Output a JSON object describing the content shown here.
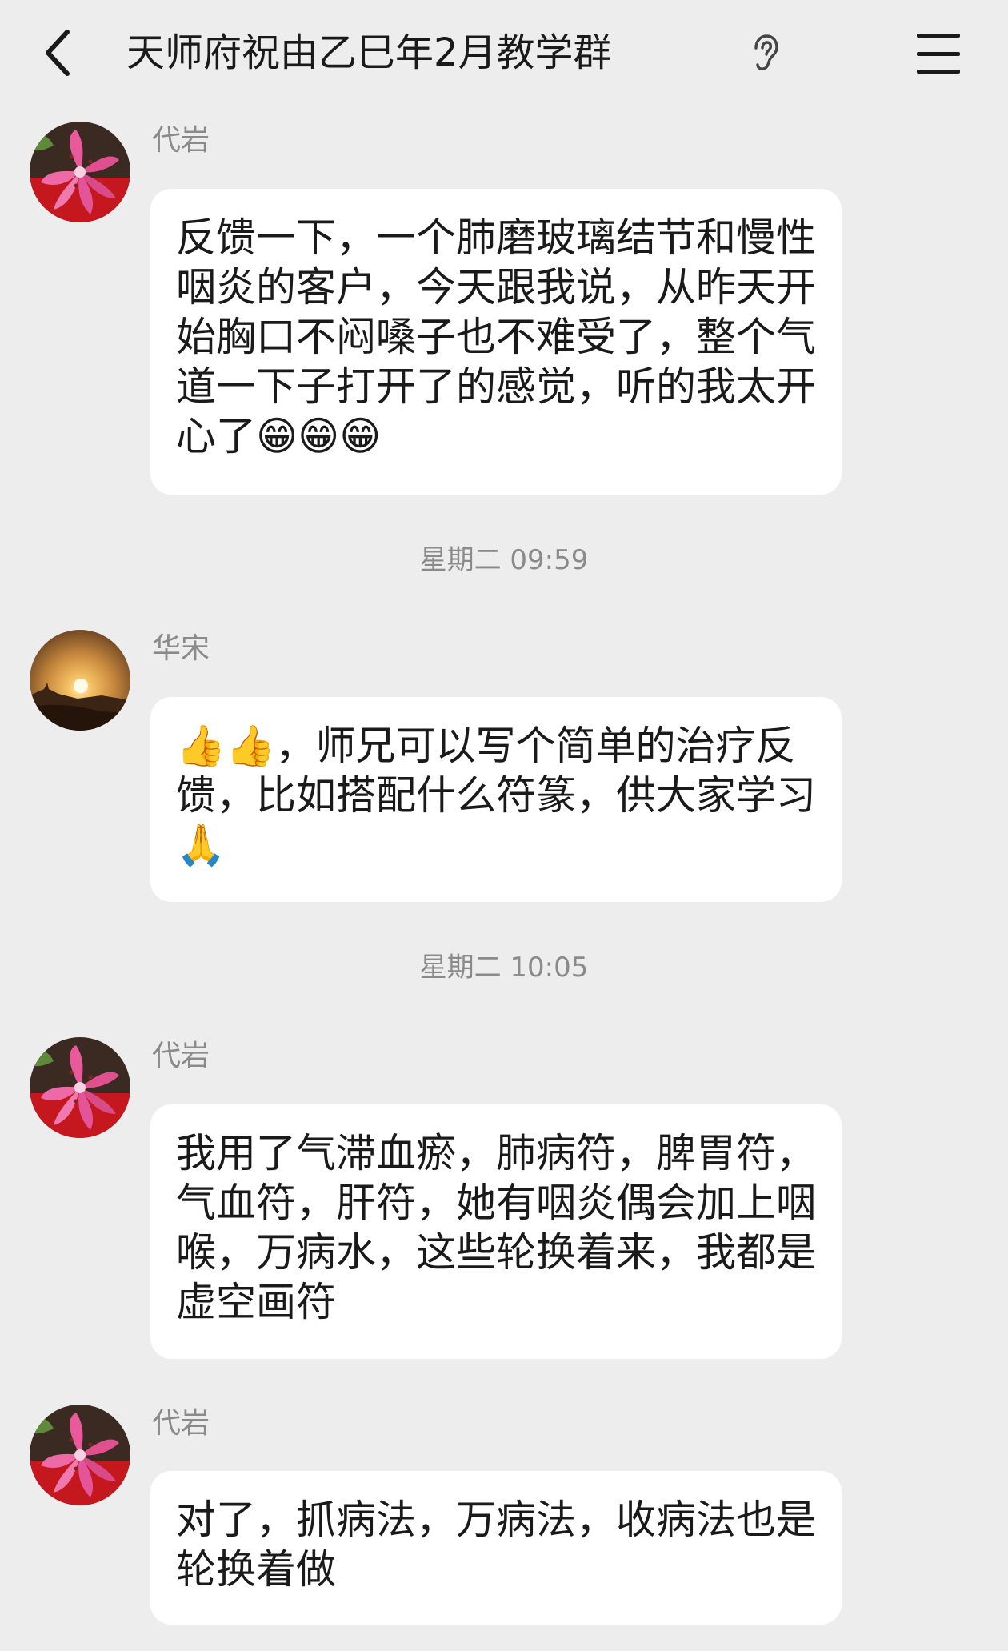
{
  "header": {
    "title": "天师府祝由乙巳年2月教学群",
    "back_icon": "chevron-left-icon",
    "ear_icon": "ear-icon",
    "menu_icon": "hamburger-menu-icon"
  },
  "messages": [
    {
      "sender": "代岩",
      "avatar": "lily-flower-avatar",
      "text": "反馈一下，一个肺磨玻璃结节和慢性咽炎的客户，今天跟我说，从昨天开始胸口不闷嗓子也不难受了，整个气道一下子打开了的感觉，听的我太开心了😁😁😁"
    },
    {
      "sender": "华宋",
      "avatar": "sunset-avatar",
      "text": "👍👍，师兄可以写个简单的治疗反馈，比如搭配什么符篆，供大家学习🙏"
    },
    {
      "sender": "代岩",
      "avatar": "lily-flower-avatar",
      "text": "我用了气滞血瘀，肺病符，脾胃符，气血符，肝符，她有咽炎偶会加上咽喉，万病水，这些轮换着来，我都是虚空画符"
    },
    {
      "sender": "代岩",
      "avatar": "lily-flower-avatar",
      "text": "对了，抓病法，万病法，收病法也是轮换着做"
    }
  ],
  "timestamps": [
    "星期二 09:59",
    "星期二 10:05"
  ],
  "colors": {
    "background": "#ededed",
    "bubble": "#ffffff",
    "text": "#1a1a1a",
    "meta_text": "#8a8a8a"
  }
}
